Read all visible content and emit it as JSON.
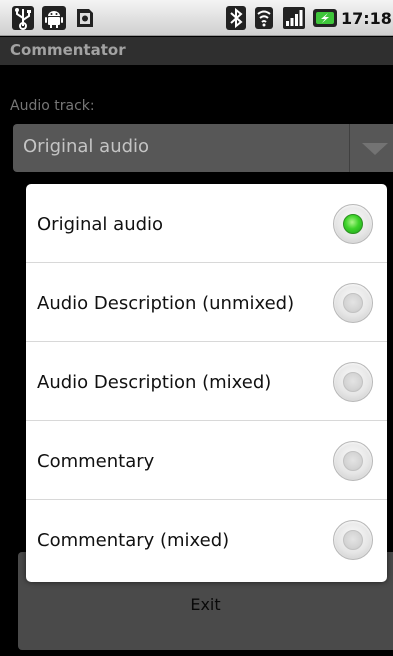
{
  "status_bar": {
    "time": "17:18",
    "icons": [
      "usb-icon",
      "android-debug-icon",
      "sd-card-icon",
      "bluetooth-icon",
      "wifi-icon",
      "signal-icon",
      "battery-charging-icon"
    ]
  },
  "app": {
    "title": "Commentator"
  },
  "audio_track": {
    "label": "Audio track:",
    "selected": "Original audio"
  },
  "dialog": {
    "options": [
      {
        "label": "Original audio",
        "checked": true
      },
      {
        "label": "Audio Description (unmixed)",
        "checked": false
      },
      {
        "label": "Audio Description (mixed)",
        "checked": false
      },
      {
        "label": "Commentary",
        "checked": false
      },
      {
        "label": "Commentary (mixed)",
        "checked": false
      }
    ]
  },
  "exit_button": {
    "label": "Exit"
  },
  "colors": {
    "radio_checked": "#3ed32a",
    "status_bar_bg": "#e2e2e2",
    "title_bar_bg": "#2f2f2f",
    "dialog_bg": "#ffffff"
  }
}
